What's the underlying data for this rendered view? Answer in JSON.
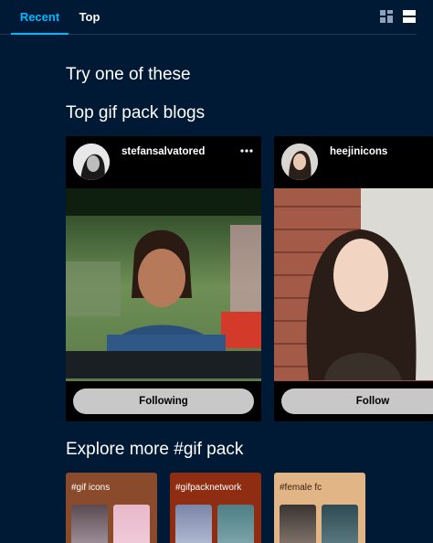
{
  "tabs": [
    {
      "label": "Recent",
      "active": true
    },
    {
      "label": "Top",
      "active": false
    }
  ],
  "view_icons": [
    "grid-view-icon",
    "list-view-icon"
  ],
  "try_title": "Try one of these",
  "top_title": "Top gif pack blogs",
  "blogs": [
    {
      "name": "stefansalvatored",
      "button": "Following"
    },
    {
      "name": "heejinicons",
      "button": "Follow"
    }
  ],
  "explore_title": "Explore more #gif pack",
  "tags": [
    {
      "label": "#gif icons",
      "color": "#8a4a2c"
    },
    {
      "label": "#gifpacknetwork",
      "color": "#8e2d12"
    },
    {
      "label": "#female fc",
      "color": "#e2b586"
    }
  ],
  "colors": {
    "background": "#001935",
    "accent": "#00b8ff"
  }
}
